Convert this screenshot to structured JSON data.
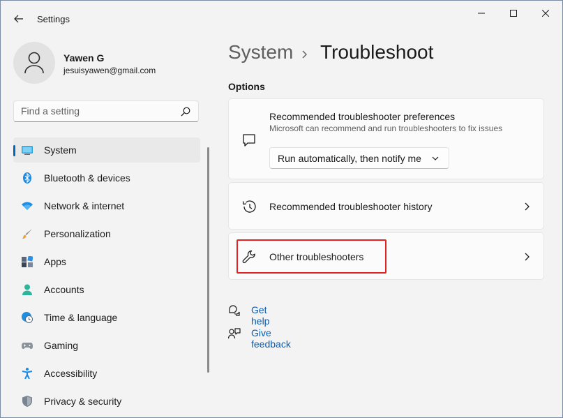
{
  "app": {
    "title": "Settings"
  },
  "window_controls": {
    "minimize": "minimize",
    "maximize": "maximize",
    "close": "close"
  },
  "profile": {
    "name": "Yawen G",
    "email": "jesuisyawen@gmail.com"
  },
  "search": {
    "placeholder": "Find a setting"
  },
  "sidebar": {
    "items": [
      {
        "label": "System",
        "icon": "monitor-icon",
        "active": true
      },
      {
        "label": "Bluetooth & devices",
        "icon": "bluetooth-icon"
      },
      {
        "label": "Network & internet",
        "icon": "wifi-icon"
      },
      {
        "label": "Personalization",
        "icon": "brush-icon"
      },
      {
        "label": "Apps",
        "icon": "apps-icon"
      },
      {
        "label": "Accounts",
        "icon": "person-icon"
      },
      {
        "label": "Time & language",
        "icon": "clock-globe-icon"
      },
      {
        "label": "Gaming",
        "icon": "gamepad-icon"
      },
      {
        "label": "Accessibility",
        "icon": "accessibility-icon"
      },
      {
        "label": "Privacy & security",
        "icon": "shield-icon"
      }
    ]
  },
  "breadcrumb": {
    "parent": "System",
    "current": "Troubleshoot"
  },
  "options": {
    "heading": "Options",
    "cards": [
      {
        "title": "Recommended troubleshooter preferences",
        "subtitle": "Microsoft can recommend and run troubleshooters to fix issues",
        "icon": "chat-bubble-icon",
        "dropdown_value": "Run automatically, then notify me"
      },
      {
        "title": "Recommended troubleshooter history",
        "icon": "history-icon"
      },
      {
        "title": "Other troubleshooters",
        "icon": "wrench-icon"
      }
    ]
  },
  "links": {
    "help": "Get help",
    "feedback": "Give feedback"
  },
  "colors": {
    "accent": "#0067c0",
    "highlight": "#e02424",
    "link": "#0b5cad"
  }
}
